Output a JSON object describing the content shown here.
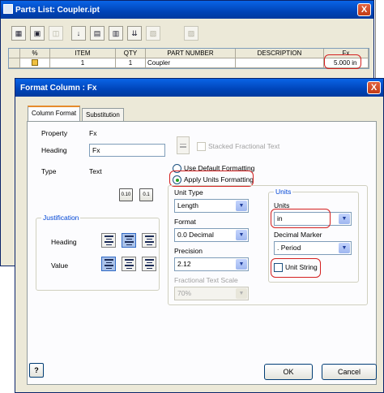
{
  "parts_list": {
    "title": "Parts List: Coupler.ipt",
    "close_glyph": "X",
    "columns": [
      "%",
      "ITEM",
      "QTY",
      "PART NUMBER",
      "DESCRIPTION",
      "Fx"
    ],
    "row": {
      "item": "1",
      "qty": "1",
      "part_number": "Coupler",
      "description": "",
      "fx": "5.000 in"
    },
    "toolbar_icons": [
      "filter-icon",
      "export-icon",
      "disabled-view-icon",
      "sort-icon",
      "save-icon",
      "member-icon",
      "column-chooser-icon",
      "disabled-group-icon",
      "disabled-icon"
    ]
  },
  "format_column": {
    "title": "Format Column : Fx",
    "close_glyph": "X",
    "tabs": [
      "Column Format",
      "Substitution"
    ],
    "property_label": "Property",
    "property_value": "Fx",
    "heading_label": "Heading",
    "heading_value": "Fx",
    "type_label": "Type",
    "type_value": "Text",
    "stacked_label": "Stacked Fractional Text",
    "use_default_label": "Use Default Formatting",
    "apply_units_label": "Apply Units Formatting",
    "precision_btn_a": "0.10",
    "precision_btn_b": "0.1",
    "justification_title": "Justification",
    "justification_heading_label": "Heading",
    "justification_value_label": "Value",
    "unit_type_label": "Unit Type",
    "unit_type_value": "Length",
    "format_label": "Format",
    "format_value": "0.0 Decimal",
    "precision_label": "Precision",
    "precision_value": "2.12",
    "fractional_scale_label": "Fractional Text Scale",
    "fractional_scale_value": "70%",
    "units_group_title": "Units",
    "units_label": "Units",
    "units_value": "in",
    "decimal_marker_label": "Decimal Marker",
    "decimal_marker_value": ". Period",
    "unit_string_label": "Unit String",
    "help_glyph": "?",
    "ok_label": "OK",
    "cancel_label": "Cancel"
  },
  "colors": {
    "titlebar": "#0a55d5",
    "dialog_bg": "#ece9d8",
    "highlight_ring": "#d42020",
    "group_title": "#0046d5"
  }
}
